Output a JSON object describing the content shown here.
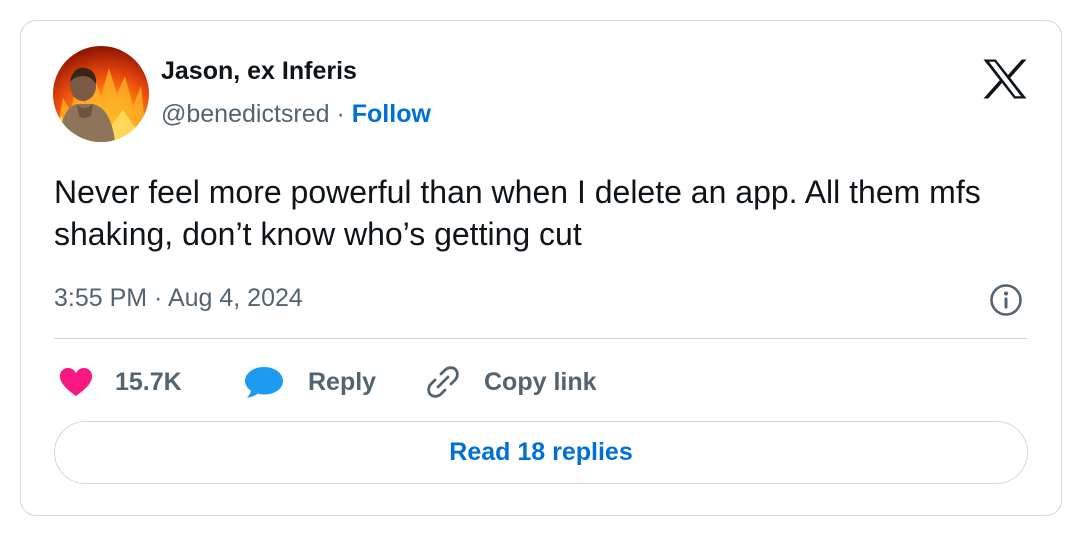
{
  "author": {
    "display_name": "Jason, ex Inferis",
    "handle": "@benedictsred",
    "separator": "·",
    "follow_label": "Follow"
  },
  "brand_icon": "x-logo-icon",
  "tweet": {
    "text": "Never feel more powerful than when I delete an app. All them mfs shaking, don’t know who’s getting cut",
    "timestamp": "3:55 PM · Aug 4, 2024"
  },
  "actions": {
    "like_count": "15.7K",
    "reply_label": "Reply",
    "copy_link_label": "Copy link"
  },
  "read_replies_label": "Read 18 replies",
  "colors": {
    "accent": "#006fd6",
    "like": "#f91880",
    "reply_bubble": "#1d9bf0",
    "text": "#0f1419",
    "muted": "#536471",
    "border": "#cfd9de"
  }
}
